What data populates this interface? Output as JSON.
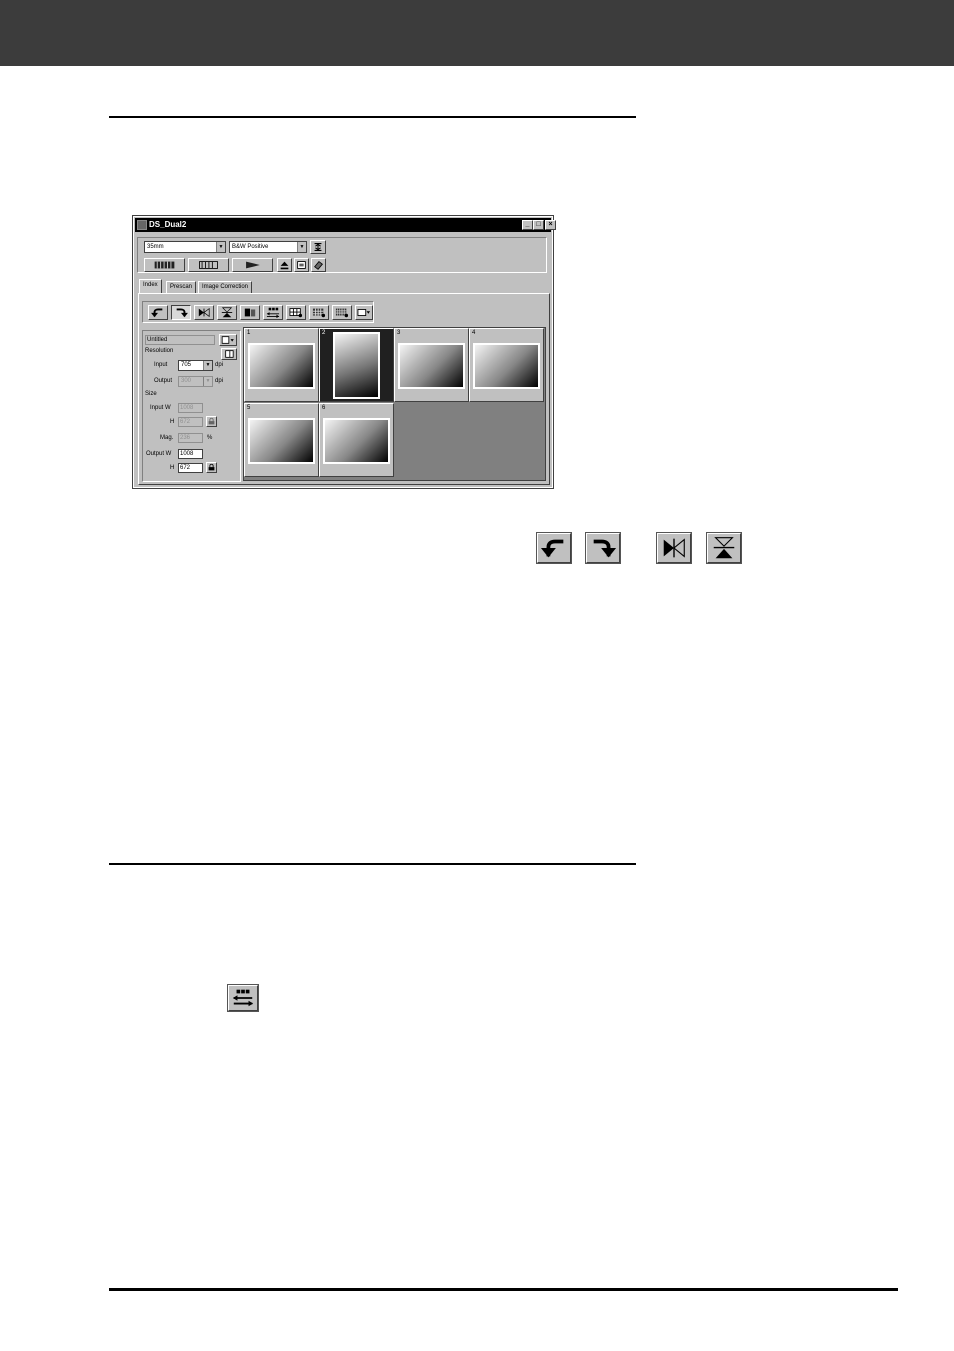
{
  "window": {
    "title": "DS_Dual2",
    "controls": [
      "_",
      "□",
      "×"
    ],
    "film_format": "35mm",
    "film_type": "B&W Positive",
    "tabs": [
      "Index",
      "Prescan",
      "Image Correction"
    ]
  },
  "settings": {
    "job_name": "Untitled",
    "resolution_label": "Resolution",
    "input_label": "Input",
    "input_value": "705",
    "input_unit": "dpi",
    "output_label": "Output",
    "output_value": "300",
    "output_unit": "dpi",
    "size_label": "Size",
    "input_w_label": "Input W",
    "input_w_value": "1008",
    "h_label": "H",
    "input_h_value": "672",
    "mag_label": "Mag.",
    "mag_value": "236",
    "mag_unit": "%",
    "output_w_label": "Output W",
    "output_w_value": "1008",
    "output_h_value": "672"
  },
  "frames": [
    "1",
    "2",
    "3",
    "4",
    "5",
    "6"
  ],
  "selected_frame": "2",
  "icons": {
    "rotate_left": "rotate-left-icon",
    "rotate_right": "rotate-right-icon",
    "flip_horizontal": "flip-horizontal-icon",
    "flip_vertical": "flip-vertical-icon",
    "reverse_order": "reverse-order-icon"
  }
}
